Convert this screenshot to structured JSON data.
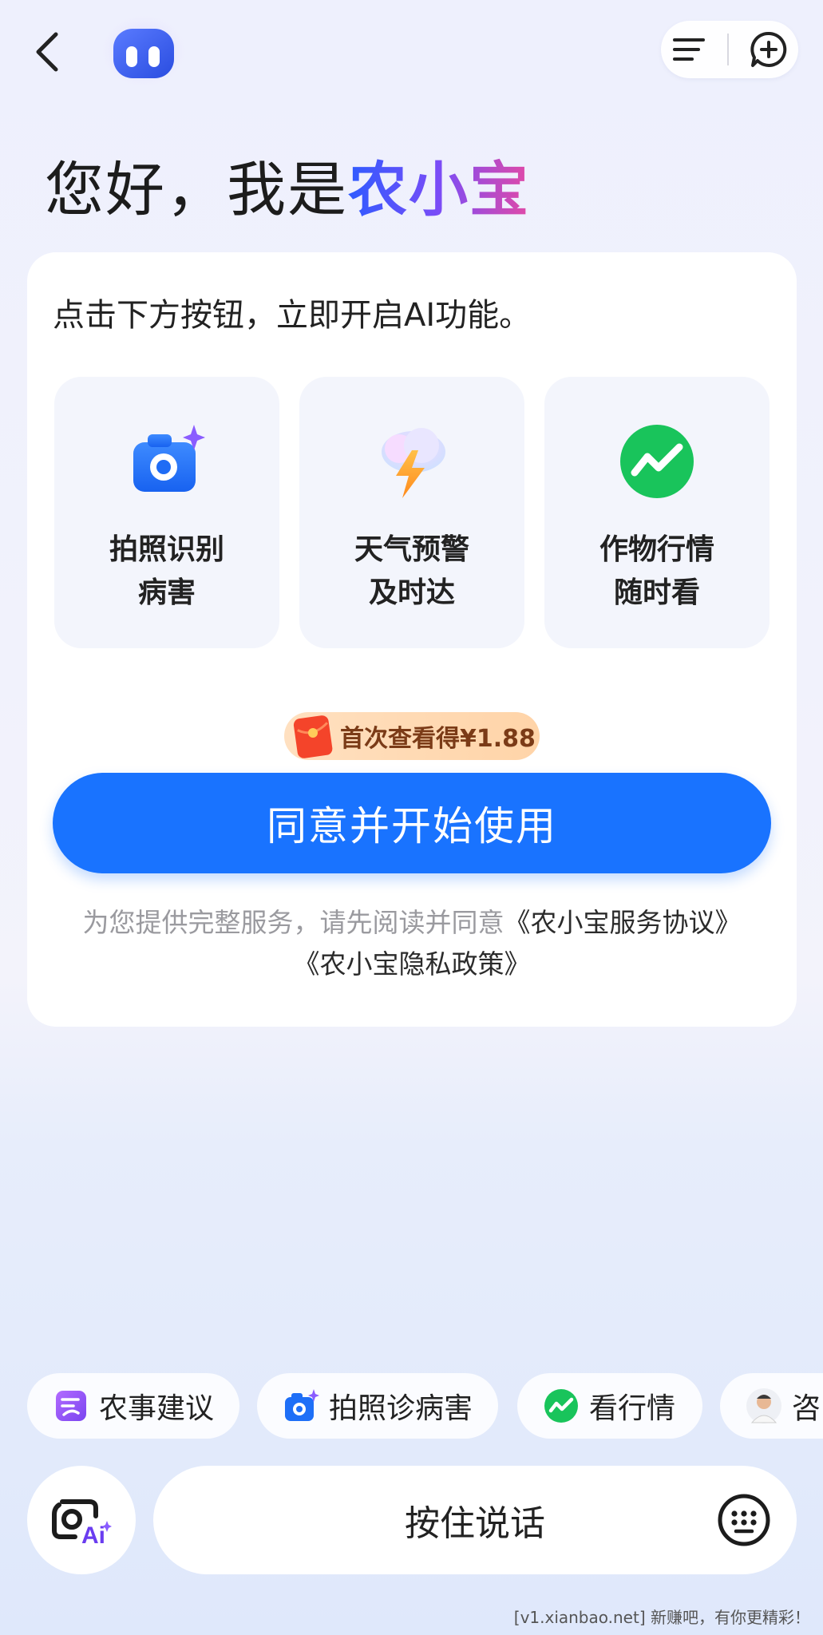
{
  "header": {
    "back_icon": "chevron-left-icon",
    "assistant_avatar": "assistant-avatar-icon",
    "menu_icon": "menu-lines-icon",
    "new_chat_icon": "new-chat-icon"
  },
  "greeting": {
    "prefix": "您好，我是",
    "brand": "农小宝"
  },
  "card": {
    "intro": "点击下方按钮，立即开启AI功能。",
    "features": [
      {
        "line1": "拍照识别",
        "line2": "病害",
        "icon": "camera-sparkle-icon"
      },
      {
        "line1": "天气预警",
        "line2": "及时达",
        "icon": "weather-lightning-icon"
      },
      {
        "line1": "作物行情",
        "line2": "随时看",
        "icon": "market-trend-icon"
      }
    ],
    "reward": "首次查看得¥1.88",
    "agree_button": "同意并开始使用",
    "agreement_text": "为您提供完整服务，请先阅读并同意",
    "agreement_link1": "《农小宝服务协议》",
    "agreement_link2": "《农小宝隐私政策》"
  },
  "chips": [
    {
      "label": "农事建议",
      "icon": "farm-advice-icon"
    },
    {
      "label": "拍照诊病害",
      "icon": "camera-diagnose-icon"
    },
    {
      "label": "看行情",
      "icon": "market-trend-icon"
    },
    {
      "label": "咨",
      "icon": "expert-avatar-icon"
    }
  ],
  "bottom": {
    "ai_camera_icon": "ai-camera-icon",
    "voice_label": "按住说话",
    "keyboard_icon": "keyboard-icon"
  },
  "watermark": "[v1.xianbao.net] 新赚吧，有你更精彩！",
  "colors": {
    "primary": "#1973ff",
    "brand_gradient": [
      "#2f5bff",
      "#7a4cf7",
      "#e24aa6"
    ],
    "market_green": "#19c45b",
    "reward_bg": "#ffd9b3"
  }
}
